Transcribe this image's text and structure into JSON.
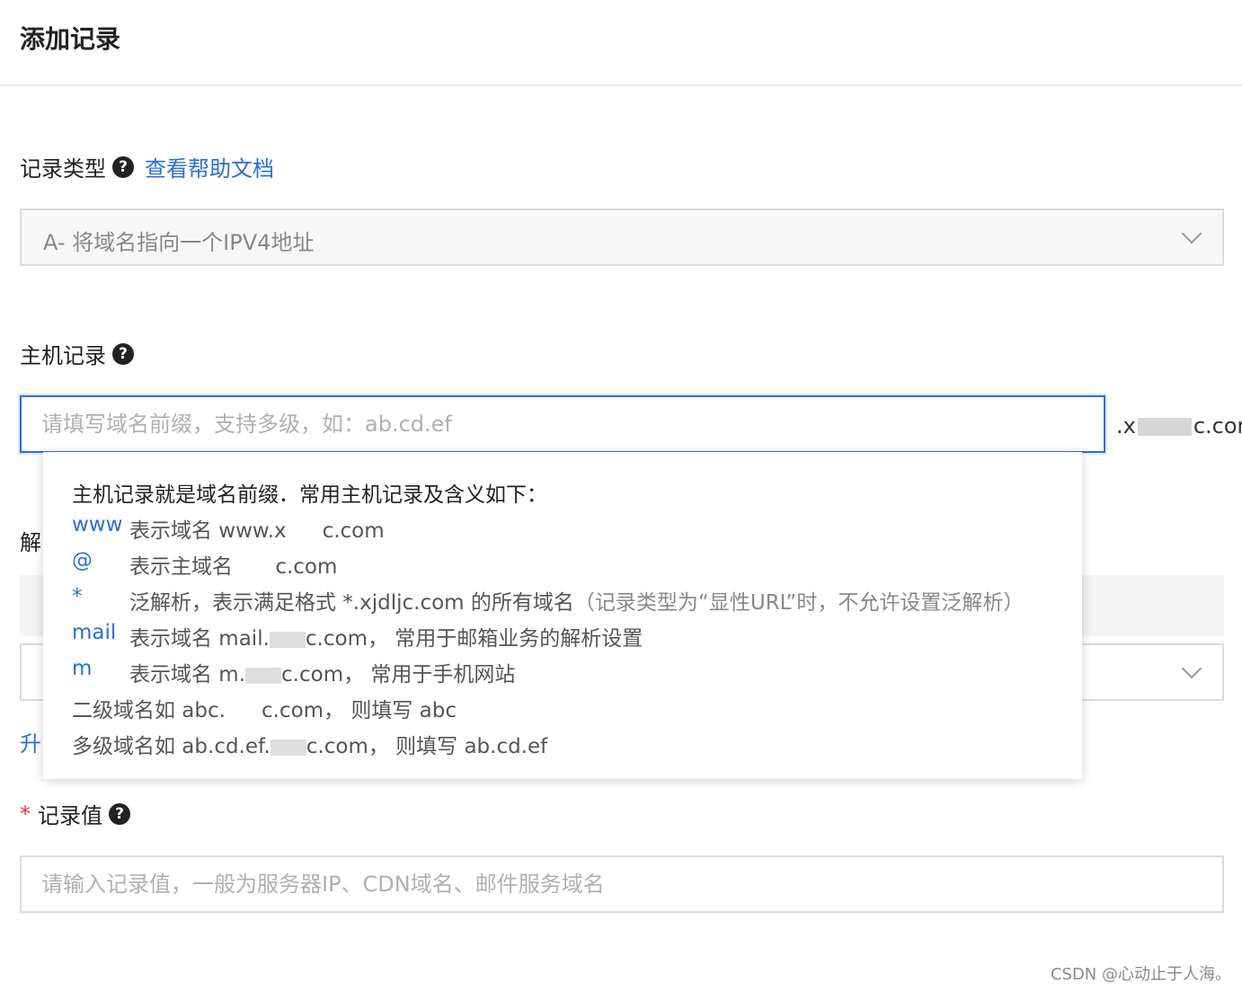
{
  "page": {
    "title": "添加记录"
  },
  "record_type": {
    "label": "记录类型",
    "help_link": "查看帮助文档",
    "selected": "A- 将域名指向一个IPV4地址"
  },
  "host": {
    "label": "主机记录",
    "placeholder": "请填写域名前缀，支持多级，如：ab.cd.ef",
    "suffix_start": ".x",
    "suffix_end": "c.com"
  },
  "hidden_fields": {
    "line_label": "解",
    "upgrade_link": "升"
  },
  "tooltip": {
    "intro": "主机记录就是域名前缀．常用主机记录及含义如下：",
    "rows": [
      {
        "key": "www",
        "desc": "表示域名 www.x",
        "desc2": "c.com"
      },
      {
        "key": "@",
        "desc": "表示主域名 ",
        "desc2": "c.com"
      },
      {
        "key": "*",
        "desc": "泛解析，表示满足格式 *.xjdljc.com 的所有域名",
        "note": "（记录类型为“显性URL”时，不允许设置泛解析）"
      },
      {
        "key": "mail",
        "desc": "表示域名 mail.",
        "desc2": "c.com， 常用于邮箱业务的解析设置"
      },
      {
        "key": "m",
        "desc": "表示域名 m.",
        "desc2": "c.com， 常用于手机网站"
      }
    ],
    "line_second": {
      "a": "二级域名如 abc.",
      "b": "c.com， 则填写 abc"
    },
    "line_multi": {
      "a": "多级域名如 ab.cd.ef.",
      "b": "c.com， 则填写 ab.cd.ef"
    }
  },
  "record_value": {
    "label": "记录值",
    "placeholder": "请输入记录值，一般为服务器IP、CDN域名、邮件服务域名"
  },
  "watermark": "CSDN @心动止于人海。"
}
